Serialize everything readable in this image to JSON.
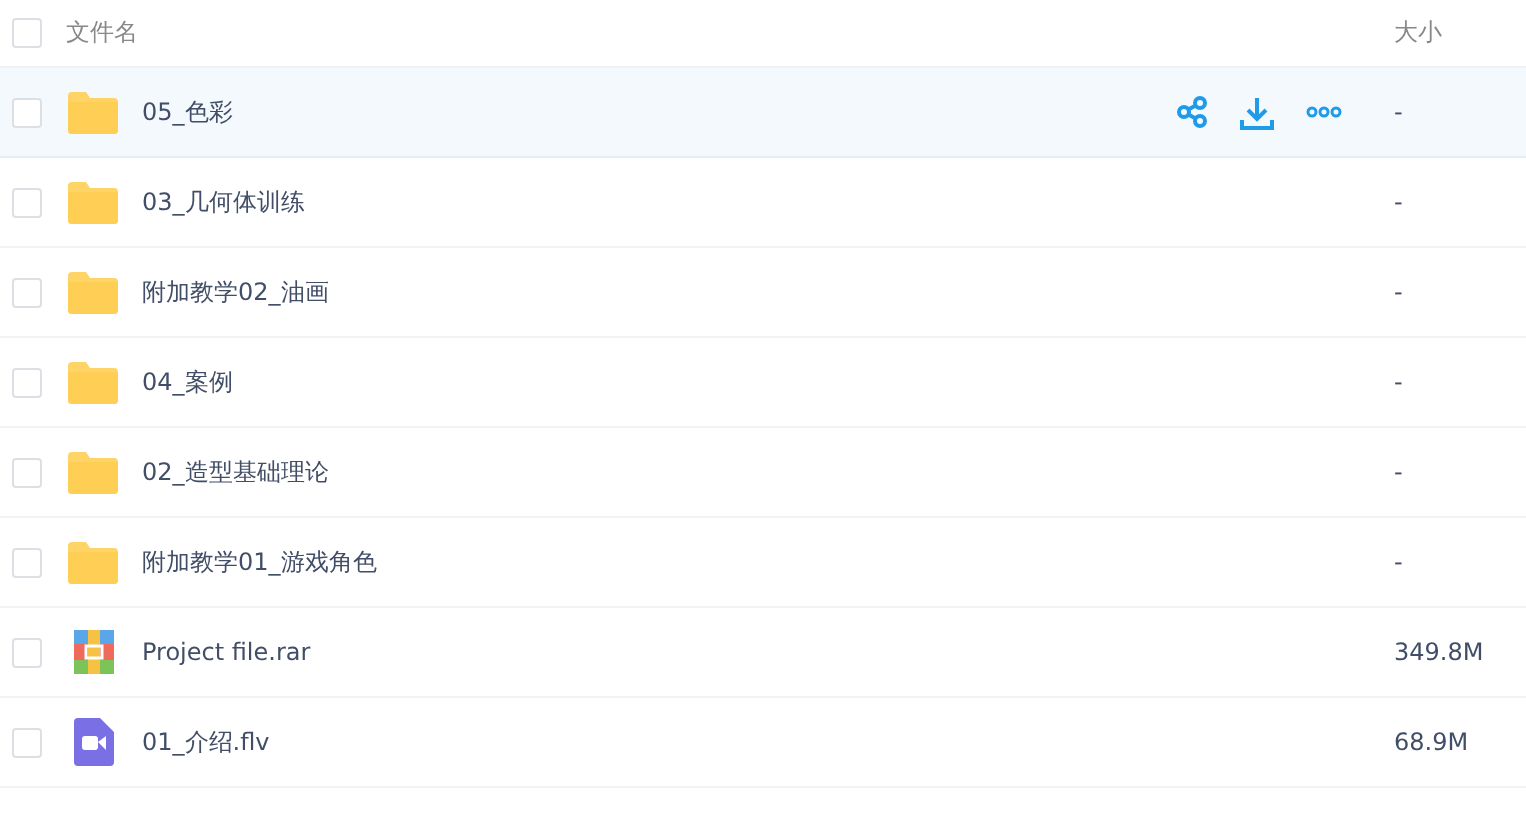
{
  "header": {
    "name": "文件名",
    "size": "大小",
    "checked": false
  },
  "rows": [
    {
      "kind": "folder",
      "name": "05_色彩",
      "size": "-",
      "checked": false,
      "highlighted": true
    },
    {
      "kind": "folder",
      "name": "03_几何体训练",
      "size": "-",
      "checked": false,
      "highlighted": false
    },
    {
      "kind": "folder",
      "name": "附加教学02_油画",
      "size": "-",
      "checked": false,
      "highlighted": false
    },
    {
      "kind": "folder",
      "name": "04_案例",
      "size": "-",
      "checked": false,
      "highlighted": false
    },
    {
      "kind": "folder",
      "name": "02_造型基础理论",
      "size": "-",
      "checked": false,
      "highlighted": false
    },
    {
      "kind": "folder",
      "name": "附加教学01_游戏角色",
      "size": "-",
      "checked": false,
      "highlighted": false
    },
    {
      "kind": "archive",
      "name": "Project file.rar",
      "size": "349.8M",
      "checked": false,
      "highlighted": false
    },
    {
      "kind": "video",
      "name": "01_介绍.flv",
      "size": "68.9M",
      "checked": false,
      "highlighted": false
    }
  ]
}
